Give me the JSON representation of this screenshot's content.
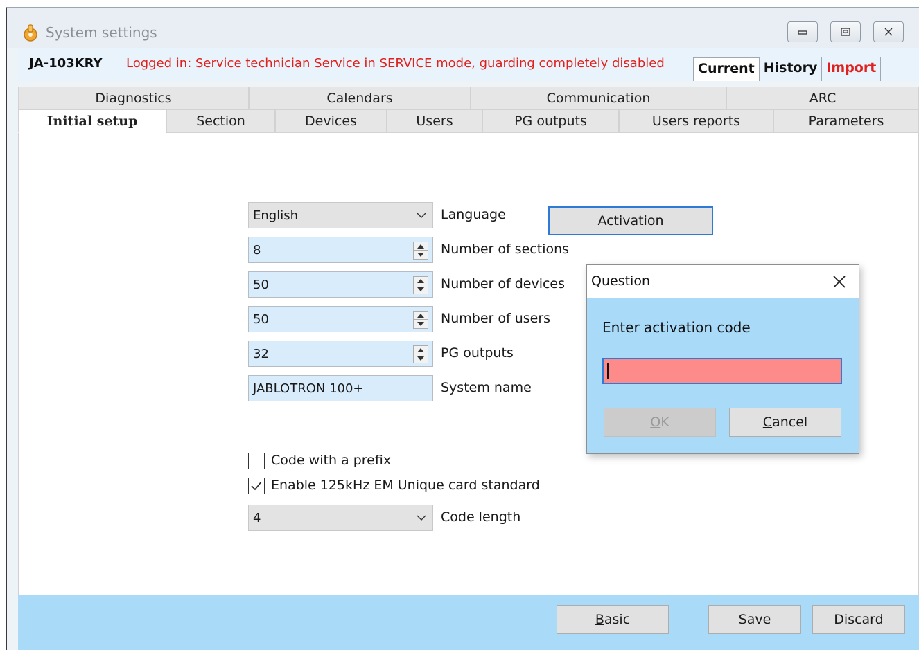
{
  "window": {
    "title": "System settings",
    "icon": "settings-app-icon"
  },
  "infobar": {
    "device_id": "JA-103KRY",
    "login_status": "Logged in: Service technician Service in SERVICE mode, guarding completely disabled",
    "view_tabs": [
      "Current",
      "History",
      "Import"
    ],
    "active_view": "Current"
  },
  "tabs": {
    "row1": [
      "Diagnostics",
      "Calendars",
      "Communication",
      "ARC"
    ],
    "row2": [
      "Initial setup",
      "Section",
      "Devices",
      "Users",
      "PG outputs",
      "Users reports",
      "Parameters"
    ],
    "active": "Initial setup"
  },
  "form": {
    "language": {
      "value": "English",
      "label": "Language"
    },
    "sections": {
      "value": "8",
      "label": "Number of sections"
    },
    "devices": {
      "value": "50",
      "label": "Number of devices"
    },
    "users": {
      "value": "50",
      "label": "Number of users"
    },
    "pg_outputs": {
      "value": "32",
      "label": "PG outputs"
    },
    "system_name": {
      "value": "JABLOTRON 100+",
      "label": "System name"
    },
    "activation_label": "Activation",
    "code_prefix": {
      "label": "Code with a prefix",
      "checked": false
    },
    "em_card": {
      "label": "Enable 125kHz EM Unique card standard",
      "checked": true
    },
    "code_length": {
      "value": "4",
      "label": "Code length"
    }
  },
  "footer": {
    "basic": {
      "pre": "",
      "ul": "B",
      "post": "asic"
    },
    "save_label": "Save",
    "discard_label": "Discard"
  },
  "dialog": {
    "title": "Question",
    "prompt": "Enter activation code",
    "input_value": "",
    "ok": {
      "pre": "",
      "ul": "O",
      "post": "K"
    },
    "cancel": {
      "pre": "",
      "ul": "C",
      "post": "ancel"
    }
  },
  "colors": {
    "status_red": "#e0201c",
    "footer_blue": "#a9daf8",
    "field_blue": "#d9ecfb",
    "error_input": "#fd8b89",
    "focus_blue": "#2f7ad6"
  }
}
